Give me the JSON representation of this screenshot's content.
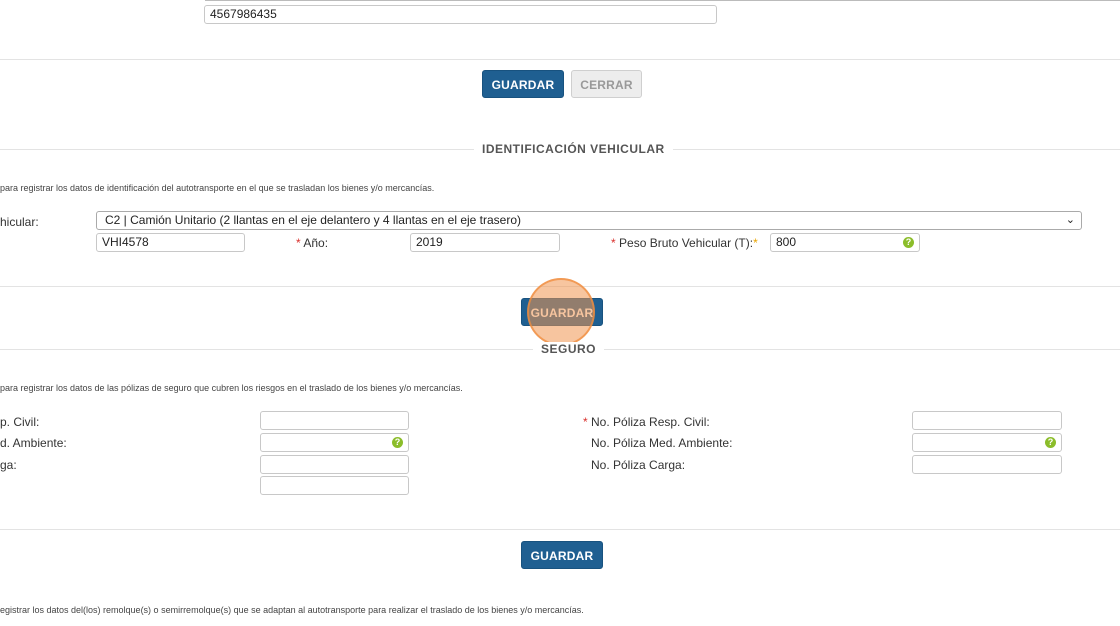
{
  "top": {
    "phone_value": "4567986435",
    "save_label": "GUARDAR",
    "close_label": "CERRAR"
  },
  "vehicle": {
    "section_title": "IDENTIFICACIÓN VEHICULAR",
    "description": "para registrar los datos de identificación del autotransporte en el que se trasladan los bienes y/o mercancías.",
    "config_label": "hicular:",
    "config_value": "C2 | Camión Unitario (2 llantas en el eje delantero y 4 llantas en el eje trasero)",
    "plate_value": "VHI4578",
    "year_label": "Año:",
    "year_value": "2019",
    "weight_label": "Peso Bruto Vehicular (T):",
    "weight_value": "800",
    "save_label": "GUARDAR"
  },
  "insurance": {
    "section_title": "SEGURO",
    "description": "para registrar los datos de las pólizas de seguro que cubren los riesgos en el traslado de los bienes y/o mercancías.",
    "left_labels": [
      "p. Civil:",
      "d. Ambiente:",
      "ga:"
    ],
    "right_labels": [
      "No. Póliza Resp. Civil:",
      "No. Póliza Med. Ambiente:",
      "No. Póliza Carga:"
    ],
    "save_label": "GUARDAR"
  },
  "trailer": {
    "description": "egistrar los datos del(los) remolque(s) o semirremolque(s) que se adaptan al autotransporte para realizar el traslado de los bienes y/o mercancías."
  },
  "colors": {
    "primary": "#1f5f91",
    "required": "#d9302c",
    "help": "#8bbd2a",
    "highlight": "#f0964f"
  },
  "icons": {
    "help": "question-mark-circle-icon",
    "dropdown": "chevron-down-icon"
  }
}
